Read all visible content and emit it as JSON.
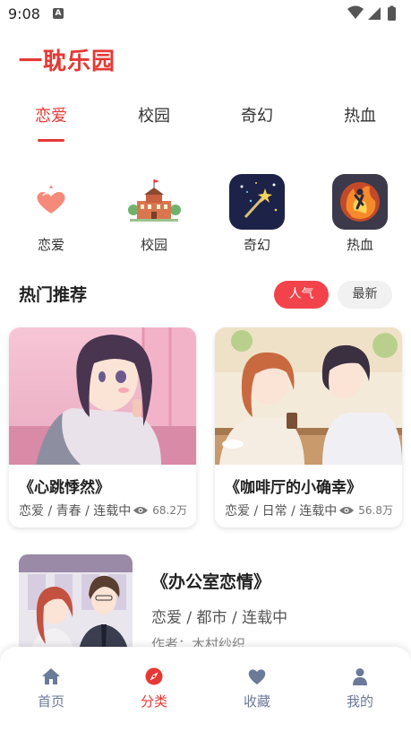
{
  "status": {
    "time": "9:08",
    "notif_letter": "A"
  },
  "app": {
    "title": "一耽乐园"
  },
  "tabs": [
    {
      "label": "恋爱",
      "active": true
    },
    {
      "label": "校园",
      "active": false
    },
    {
      "label": "奇幻",
      "active": false
    },
    {
      "label": "热血",
      "active": false
    }
  ],
  "categories": [
    {
      "label": "恋爱",
      "icon": "heart-icon"
    },
    {
      "label": "校园",
      "icon": "school-building-icon"
    },
    {
      "label": "奇幻",
      "icon": "magic-wand-icon"
    },
    {
      "label": "热血",
      "icon": "fire-fighter-icon"
    }
  ],
  "section": {
    "title": "热门推荐",
    "chip_hot": "人气",
    "chip_new": "最新"
  },
  "cards": [
    {
      "title": "《心跳悸然》",
      "tags": "恋爱 / 青春 / 连载中",
      "views": "68.2万"
    },
    {
      "title": "《咖啡厅的小确幸》",
      "tags": "恋爱 / 日常 / 连载中",
      "views": "56.8万"
    }
  ],
  "list": [
    {
      "title": "《办公室恋情》",
      "tags": "恋爱 / 都市 / 连载中",
      "author": "作者：木村纱织"
    }
  ],
  "nav": [
    {
      "label": "首页",
      "icon": "home-icon",
      "active": false
    },
    {
      "label": "分类",
      "icon": "compass-icon",
      "active": true
    },
    {
      "label": "收藏",
      "icon": "heart-icon",
      "active": false
    },
    {
      "label": "我的",
      "icon": "person-icon",
      "active": false
    }
  ],
  "colors": {
    "accent": "#e53935",
    "nav_inactive": "#6b7a99"
  }
}
